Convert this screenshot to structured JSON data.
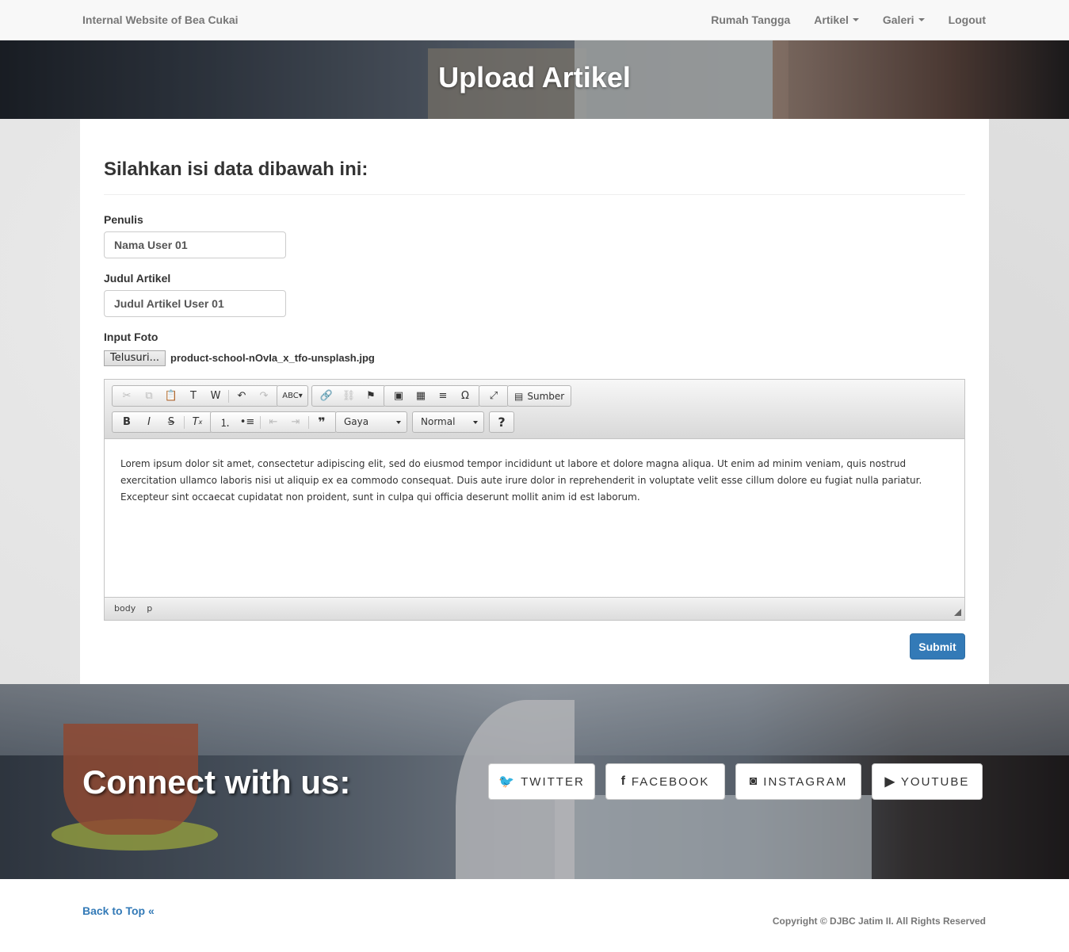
{
  "navbar": {
    "brand": "Internal Website of Bea Cukai",
    "items": [
      {
        "label": "Rumah Tangga",
        "dropdown": false
      },
      {
        "label": "Artikel",
        "dropdown": true
      },
      {
        "label": "Galeri",
        "dropdown": true
      },
      {
        "label": "Logout",
        "dropdown": false
      }
    ]
  },
  "header": {
    "title": "Upload Artikel"
  },
  "form": {
    "heading": "Silahkan isi data dibawah ini:",
    "penulis_label": "Penulis",
    "penulis_value": "Nama User 01",
    "judul_label": "Judul Artikel",
    "judul_value": "Judul Artikel User 01",
    "foto_label": "Input Foto",
    "browse_label": "Telusuri...",
    "file_name": "product-school-nOvIa_x_tfo-unsplash.jpg",
    "submit_label": "Submit"
  },
  "editor": {
    "source_label": "Sumber",
    "style_combo": "Gaya",
    "format_combo": "Normal",
    "help_label": "?",
    "content": "Lorem ipsum dolor sit amet, consectetur adipiscing elit, sed do eiusmod tempor incididunt ut labore et dolore magna aliqua. Ut enim ad minim veniam, quis nostrud exercitation ullamco laboris nisi ut aliquip ex ea commodo consequat. Duis aute irure dolor in reprehenderit in voluptate velit esse cillum dolore eu fugiat nulla pariatur. Excepteur sint occaecat cupidatat non proident, sunt in culpa qui officia deserunt mollit anim id est laborum.",
    "path": [
      "body",
      "p"
    ]
  },
  "connect": {
    "title": "Connect with us:",
    "buttons": [
      {
        "label": "TWITTER",
        "icon": "twitter-icon"
      },
      {
        "label": "FACEBOOK",
        "icon": "facebook-icon"
      },
      {
        "label": "INSTAGRAM",
        "icon": "instagram-icon"
      },
      {
        "label": "YOUTUBE",
        "icon": "youtube-icon"
      }
    ]
  },
  "footer": {
    "back_to_top": "Back to Top",
    "copyright": "Copyright © DJBC Jatim II. All Rights Reserved"
  },
  "colors": {
    "primary": "#337ab7",
    "navbar_bg": "#f8f8f8"
  }
}
